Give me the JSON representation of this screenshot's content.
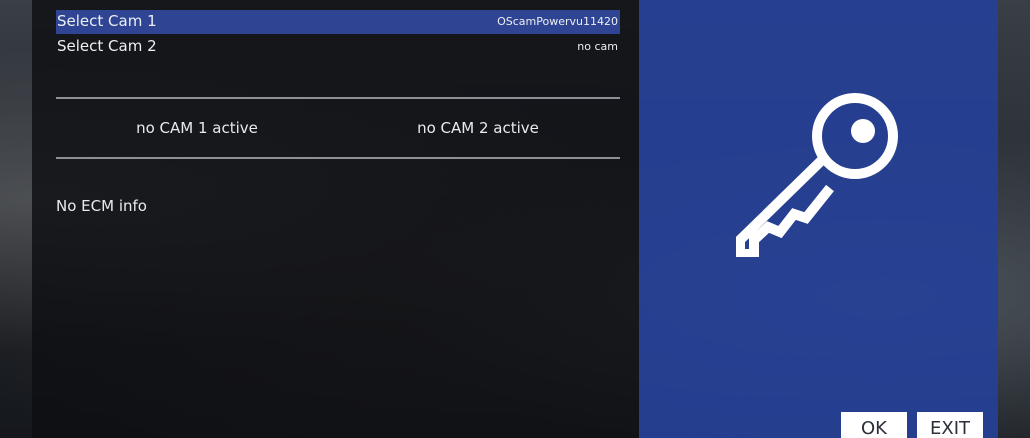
{
  "cam_list": [
    {
      "label": "Select Cam 1",
      "value": "OScamPowervu11420",
      "selected": true
    },
    {
      "label": "Select Cam 2",
      "value": "no cam",
      "selected": false
    }
  ],
  "status": {
    "cam1": "no CAM 1 active",
    "cam2": "no CAM 2 active"
  },
  "ecm_info": "No ECM info",
  "buttons": {
    "ok": "OK",
    "exit": "EXIT"
  },
  "icons": {
    "panel_icon": "key-icon"
  },
  "colors": {
    "selection": "#2f4594",
    "info_panel": "#263f96",
    "menu_panel": "#0e0f12"
  }
}
